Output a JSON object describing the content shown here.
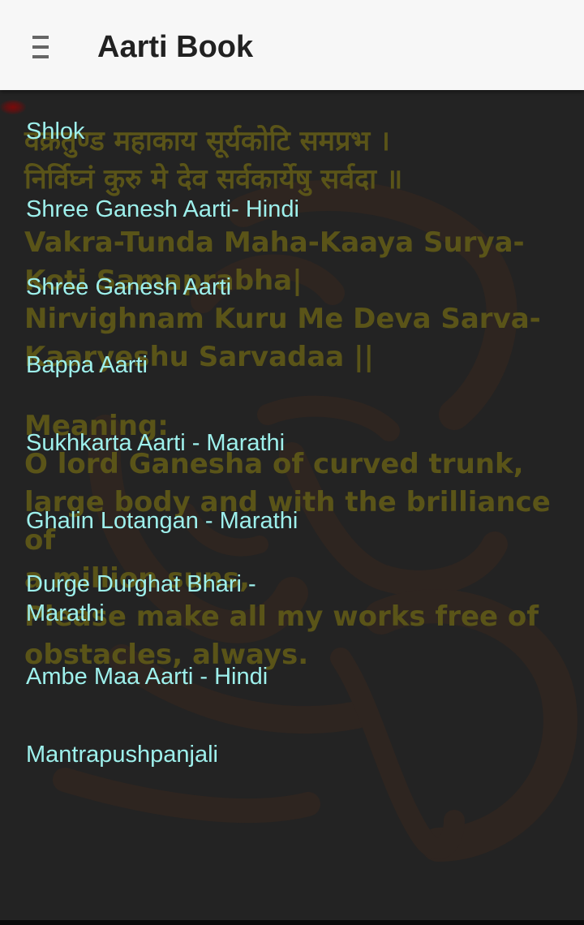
{
  "appbar": {
    "title": "Aarti Book",
    "menu_icon": "hamburger-menu-icon"
  },
  "background_text": {
    "devanagari": [
      "वक्रतुण्ड महाकाय सूर्यकोटि समप्रभ ।",
      "निर्विघ्नं कुरु मे देव सर्वकार्येषु सर्वदा  ॥"
    ],
    "english": [
      "Vakra-Tunda Maha-Kaaya Surya-",
      "Koti Samaprabha|",
      "Nirvighnam Kuru Me Deva Sarva-",
      "Kaaryeshu Sarvadaa ||"
    ],
    "meaning_label": "Meaning:",
    "meaning": [
      "O lord Ganesha of curved trunk,",
      "large body and with the brilliance of",
      "a million suns,",
      "Please make all my works free of",
      "obstacles, always."
    ]
  },
  "aarti_list": [
    "Shlok",
    "Shree Ganesh Aarti- Hindi",
    "Shree Ganesh Aarti",
    "Bappa Aarti",
    "Sukhkarta Aarti - Marathi",
    "Ghalin Lotangan - Marathi",
    "Durge Durghat Bhari - Marathi",
    "Ambe Maa Aarti - Hindi",
    "Mantrapushpanjali"
  ],
  "colors": {
    "appbar_bg": "#f7f7f7",
    "content_bg": "#232323",
    "list_text": "#9ef0ec",
    "background_text": "#5a5418",
    "watermark": "#3a2c22"
  }
}
